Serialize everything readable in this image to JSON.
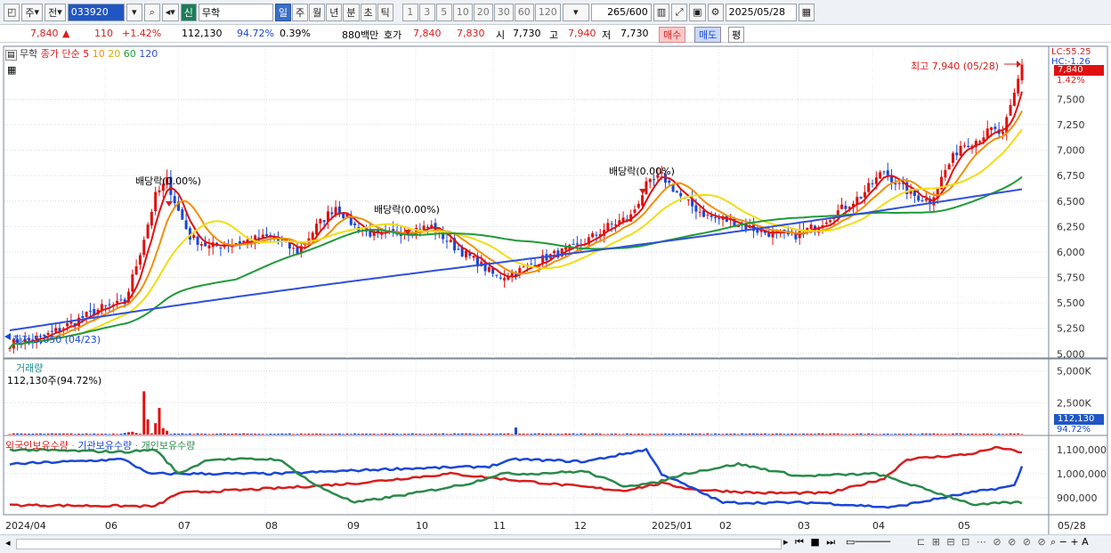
{
  "toolbar": {
    "market_type": "주",
    "prev_label": "전",
    "code": "033920",
    "badge": "신",
    "stock_name": "무학",
    "periods": [
      "일",
      "주",
      "월",
      "년",
      "분",
      "초",
      "틱"
    ],
    "active_period": "일",
    "intervals": [
      "1",
      "3",
      "5",
      "10",
      "20",
      "30",
      "60",
      "120"
    ],
    "count": "265",
    "count_total": "/600",
    "date": "2025/05/28"
  },
  "quote": {
    "price": "7,840",
    "change": "110",
    "change_pct": "+1.42%",
    "volume": "112,130",
    "vol_ratio": "94.72%",
    "turnover": "0.39%",
    "amount": "880백만",
    "bid_label": "호가",
    "bid1": "7,840",
    "bid2": "7,830",
    "open_label": "시",
    "open": "7,730",
    "high_label": "고",
    "high": "7,940",
    "low_label": "저",
    "low": "7,730",
    "buy_label": "매수",
    "sell_label": "매도",
    "even_label": "평"
  },
  "price_panel": {
    "name": "무학",
    "ma_title": "종가 단순",
    "ma_periods": [
      "5",
      "10",
      "20",
      "60",
      "120"
    ],
    "ma_colors": [
      "#e01010",
      "#f0900a",
      "#e8d000",
      "#1f9a3a",
      "#3050d8"
    ],
    "lc_label": "LC:55.25",
    "hc_label": "HC:-1.26",
    "current_price_tag": "7,840",
    "current_pct_tag": "1.42%",
    "high_note": "최고 7,940 (05/28)",
    "low_note": "최저 5,050 (04/23)",
    "dividend_label": "배당락(0.00%)",
    "y_ticks": [
      "7,500",
      "7,250",
      "7,000",
      "6,750",
      "6,500",
      "6,250",
      "6,000",
      "5,750",
      "5,500",
      "5,250",
      "5,000"
    ]
  },
  "volume_panel": {
    "title": "거래량",
    "info": "112,130주(94.72%)",
    "y_ticks": [
      "5,000K",
      "2,500K"
    ],
    "current_tag": "112,130",
    "pct_tag": "94.72%"
  },
  "holdings_panel": {
    "titles": [
      "외국인보유수량",
      "기관보유수량",
      "개인보유수량"
    ],
    "title_colors": [
      "#d81e1e",
      "#1a47d6",
      "#2a8a4a"
    ],
    "y_ticks": [
      "1,100,000",
      "1,000,000",
      "900,000"
    ]
  },
  "x_axis": {
    "labels": [
      "2024/04",
      "06",
      "07",
      "08",
      "09",
      "10",
      "11",
      "12",
      "2025/01",
      "02",
      "03",
      "04",
      "05",
      "05/28"
    ]
  },
  "chart_data": {
    "type": "line",
    "price_ma_ends": {
      "ma5": 7680,
      "ma10": 7450,
      "ma20": 7320,
      "ma60": 6900,
      "ma120": 6610
    },
    "price_high": 7940,
    "price_low": 5050,
    "ylim": [
      5000,
      7940
    ]
  }
}
